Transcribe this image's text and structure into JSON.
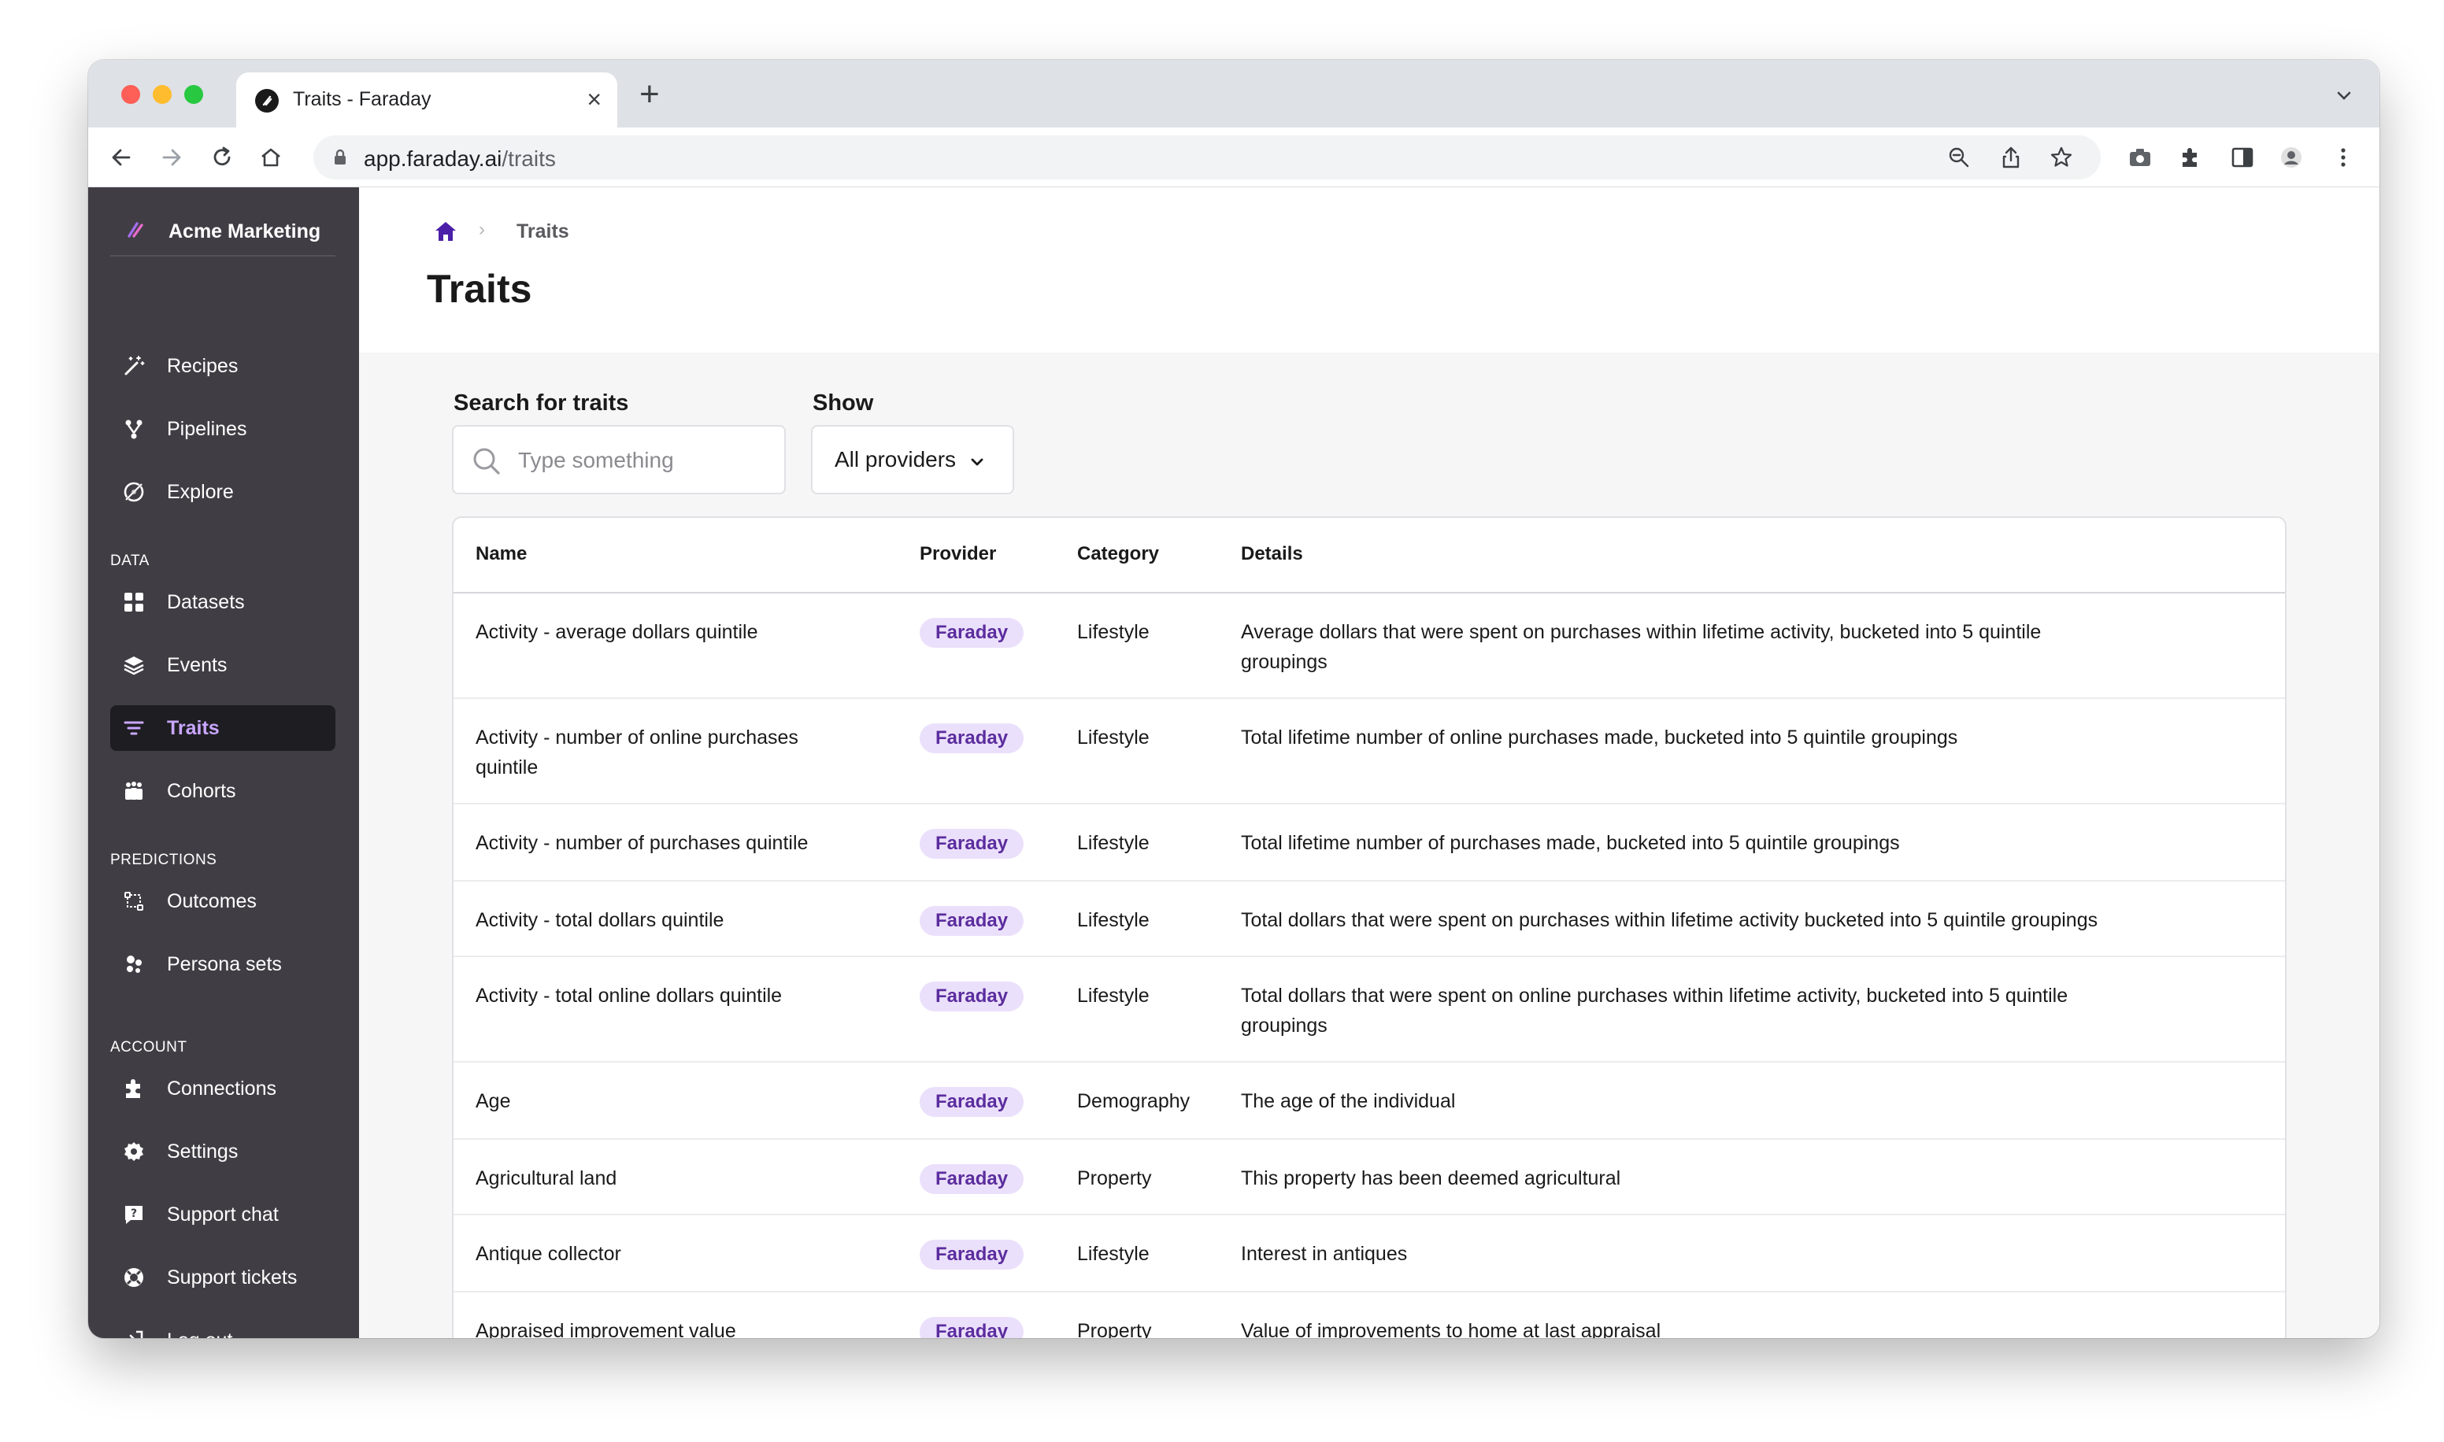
{
  "browser": {
    "tab_title": "Traits - Faraday",
    "tab_close": "×",
    "new_tab": "+",
    "url_host": "app.faraday.ai",
    "url_path": "/traits"
  },
  "sidebar": {
    "org_name": "Acme Marketing",
    "items_top": [
      {
        "label": "Recipes",
        "icon": "magic-wand-icon"
      },
      {
        "label": "Pipelines",
        "icon": "pipeline-icon"
      },
      {
        "label": "Explore",
        "icon": "explore-icon"
      }
    ],
    "data_label": "DATA",
    "items_data": [
      {
        "label": "Datasets",
        "icon": "grid-icon"
      },
      {
        "label": "Events",
        "icon": "layers-icon"
      },
      {
        "label": "Traits",
        "icon": "filter-icon",
        "active": true
      },
      {
        "label": "Cohorts",
        "icon": "people-icon"
      }
    ],
    "predictions_label": "PREDICTIONS",
    "items_predictions": [
      {
        "label": "Outcomes",
        "icon": "outcomes-icon"
      },
      {
        "label": "Persona sets",
        "icon": "personas-icon"
      }
    ],
    "account_label": "ACCOUNT",
    "items_account": [
      {
        "label": "Connections",
        "icon": "puzzle-icon"
      },
      {
        "label": "Settings",
        "icon": "gear-icon"
      },
      {
        "label": "Support chat",
        "icon": "help-chat-icon"
      },
      {
        "label": "Support tickets",
        "icon": "lifebuoy-icon"
      },
      {
        "label": "Log out",
        "icon": "logout-icon"
      }
    ],
    "accent_color": "#c9a6ff",
    "background_color": "#403e44"
  },
  "header": {
    "breadcrumb_current": "Traits",
    "breadcrumb_separator": "›",
    "title": "Traits"
  },
  "filters": {
    "search_label": "Search for traits",
    "search_placeholder": "Type something",
    "search_value": "",
    "show_label": "Show",
    "show_selected": "All providers"
  },
  "table": {
    "columns": [
      "Name",
      "Provider",
      "Category",
      "Details"
    ],
    "rows": [
      {
        "name": "Activity - average dollars quintile",
        "provider": "Faraday",
        "category": "Lifestyle",
        "details": "Average dollars that were spent on purchases within lifetime activity, bucketed into 5 quintile groupings"
      },
      {
        "name": "Activity - number of online purchases quintile",
        "provider": "Faraday",
        "category": "Lifestyle",
        "details": "Total lifetime number of online purchases made, bucketed into 5 quintile groupings"
      },
      {
        "name": "Activity - number of purchases quintile",
        "provider": "Faraday",
        "category": "Lifestyle",
        "details": "Total lifetime number of purchases made, bucketed into 5 quintile groupings"
      },
      {
        "name": "Activity - total dollars quintile",
        "provider": "Faraday",
        "category": "Lifestyle",
        "details": "Total dollars that were spent on purchases within lifetime activity bucketed into 5 quintile groupings"
      },
      {
        "name": "Activity - total online dollars quintile",
        "provider": "Faraday",
        "category": "Lifestyle",
        "details": "Total dollars that were spent on online purchases within lifetime activity, bucketed into 5 quintile groupings"
      },
      {
        "name": "Age",
        "provider": "Faraday",
        "category": "Demography",
        "details": "The age of the individual"
      },
      {
        "name": "Agricultural land",
        "provider": "Faraday",
        "category": "Property",
        "details": "This property has been deemed agricultural"
      },
      {
        "name": "Antique collector",
        "provider": "Faraday",
        "category": "Lifestyle",
        "details": "Interest in antiques"
      },
      {
        "name": "Appraised improvement value",
        "provider": "Faraday",
        "category": "Property",
        "details": "Value of improvements to home at last appraisal"
      }
    ],
    "badge_background": "#ebe0fb",
    "badge_text_color": "#5b2d9e"
  },
  "chat": {
    "icon": "chat-bubble-icon",
    "color": "#c98df4"
  }
}
